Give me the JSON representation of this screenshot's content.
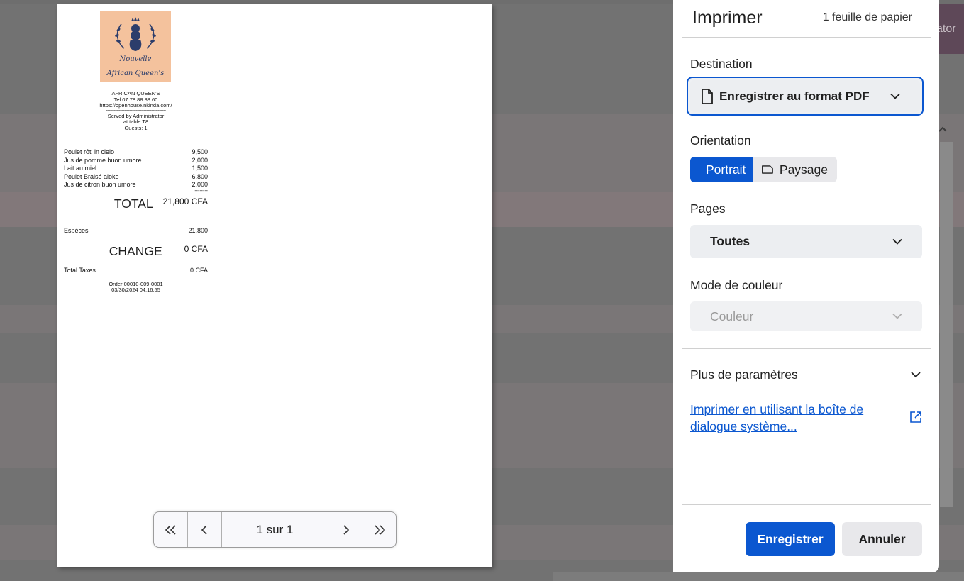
{
  "backdrop": {
    "right_tab_text": "ator"
  },
  "receipt": {
    "logo": {
      "line1": "Nouvelle",
      "line2": "African Queen's"
    },
    "header": {
      "name": "AFRICAN QUEEN'S",
      "tel": "Tel:07 78 88 88 60",
      "url": "https://openhouse.nkinda.com/",
      "dashes": "----------------------------------------------",
      "served_by": "Served by Administrator",
      "table": "at table T8",
      "guests": "Guests: 1"
    },
    "items": [
      {
        "name": "Poulet rôti in cielo",
        "price": "9,500"
      },
      {
        "name": "Jus de pomme buon umore",
        "price": "2,000"
      },
      {
        "name": "Lait au miel",
        "price": "1,500"
      },
      {
        "name": "Poulet Braisé aloko",
        "price": "6,800"
      },
      {
        "name": "Jus de citron buon umore",
        "price": "2,000"
      }
    ],
    "subtotal_dashes": "--------",
    "total_label": "TOTAL",
    "total_value": "21,800 CFA",
    "payment_label": "Espèces",
    "payment_value": "21,800",
    "change_label": "CHANGE",
    "change_value": "0 CFA",
    "taxes_label": "Total Taxes",
    "taxes_value": "0 CFA",
    "order": "Order 00010-009-0001",
    "datetime": "03/30/2024 04:16:55"
  },
  "pager": {
    "count_text": "1 sur 1"
  },
  "dialog": {
    "title": "Imprimer",
    "sheets": "1 feuille de papier",
    "destination_label": "Destination",
    "destination_value": "Enregistrer au format PDF",
    "orientation_label": "Orientation",
    "orientation_portrait": "Portrait",
    "orientation_landscape": "Paysage",
    "orientation_selected": "Portrait",
    "pages_label": "Pages",
    "pages_value": "Toutes",
    "color_label": "Mode de couleur",
    "color_value": "Couleur",
    "more_settings": "Plus de paramètres",
    "system_dialog_link": "Imprimer en utilisant la boîte de dialogue système...",
    "save_button": "Enregistrer",
    "cancel_button": "Annuler",
    "accent_color": "#0b57d0"
  }
}
